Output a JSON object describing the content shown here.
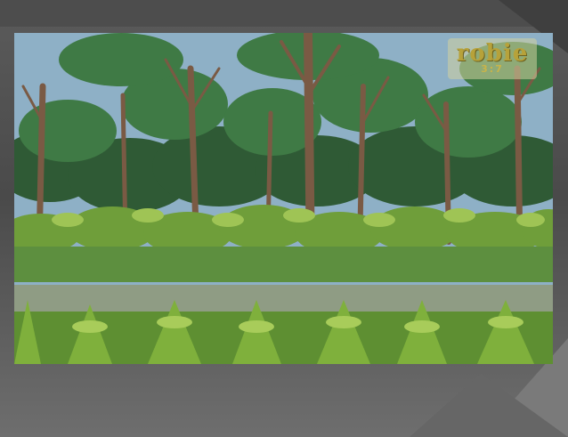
{
  "scene": {
    "description_colors": {
      "sky": "#8eb0c6",
      "canopy_dark": "#2f5a35",
      "canopy_mid": "#3f7a45",
      "trunk": "#7a5a44",
      "bush": "#6f9e3a",
      "bush_light": "#9fc455",
      "grass": "#4f8a3a",
      "path": "#8f9c84"
    }
  },
  "logo": {
    "main_text": "robie",
    "sub_text": "3:7"
  }
}
